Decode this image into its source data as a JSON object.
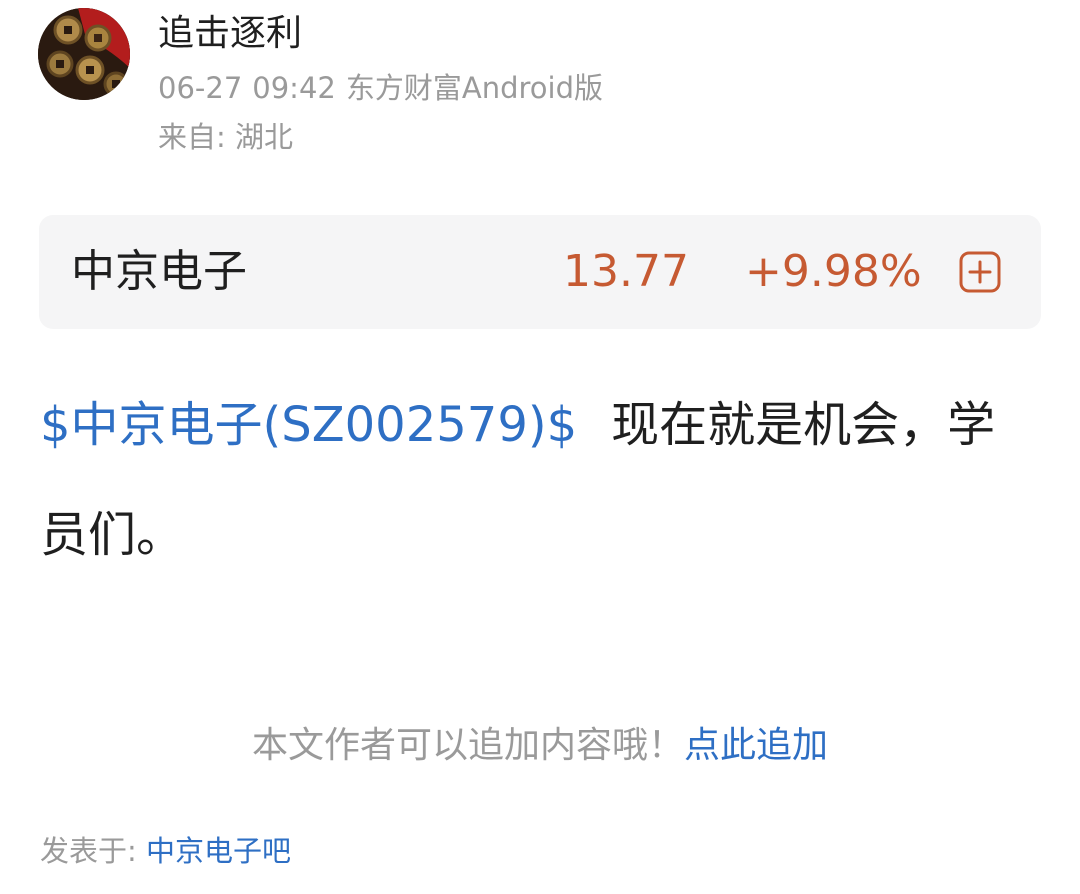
{
  "post": {
    "author": "追击逐利",
    "date": "06-27",
    "time": "09:42",
    "source": "东方财富Android版",
    "location": "来自: 湖北",
    "avatar_icon": "coins-avatar-icon"
  },
  "stock_card": {
    "name": "中京电子",
    "price": "13.77",
    "change": "+9.98%",
    "up_color": "#c65a32",
    "add_icon": "plus-square-icon"
  },
  "content": {
    "stock_link": "$中京电子(SZ002579)$",
    "text": "现在就是机会，学员们。",
    "link_color": "#2e6fc4"
  },
  "footer": {
    "hint": "本文作者可以追加内容哦！",
    "append_link": "点此追加",
    "posted_label": "发表于:",
    "bar_name": "中京电子吧"
  }
}
